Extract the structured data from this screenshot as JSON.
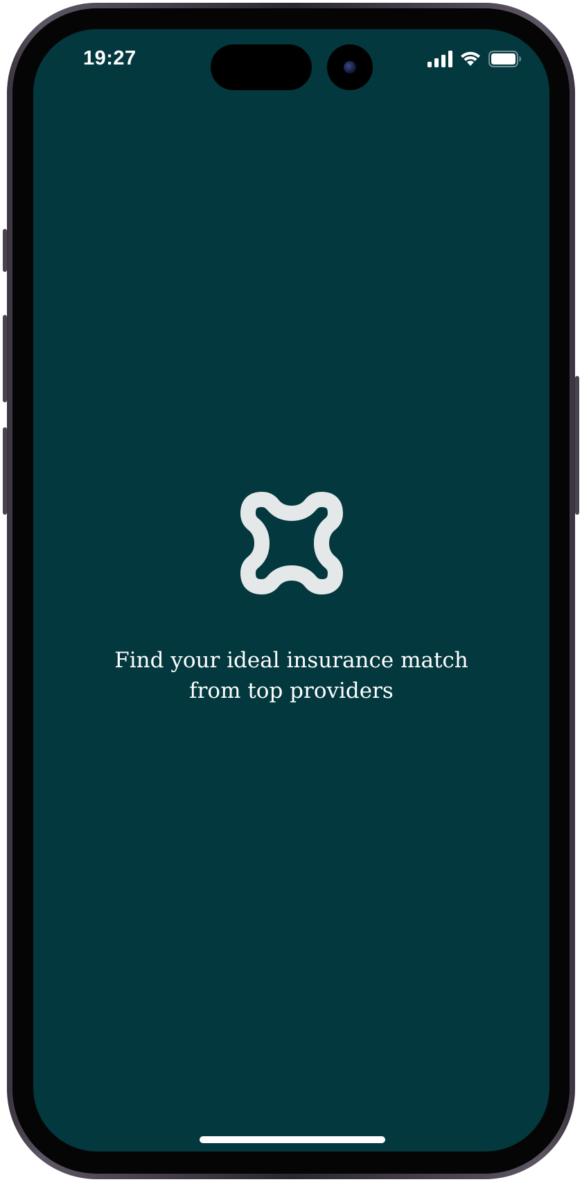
{
  "status_bar": {
    "time": "19:27",
    "signal_icon": "cellular-signal-icon",
    "wifi_icon": "wifi-icon",
    "battery_icon": "battery-icon"
  },
  "splash": {
    "logo_icon": "four-lobed-knot-logo",
    "tagline_line1": "Find your ideal insurance match",
    "tagline_line2": "from top providers"
  },
  "colors": {
    "background": "#03383e",
    "logo": "#e4e8e8",
    "text": "#ffffff"
  }
}
